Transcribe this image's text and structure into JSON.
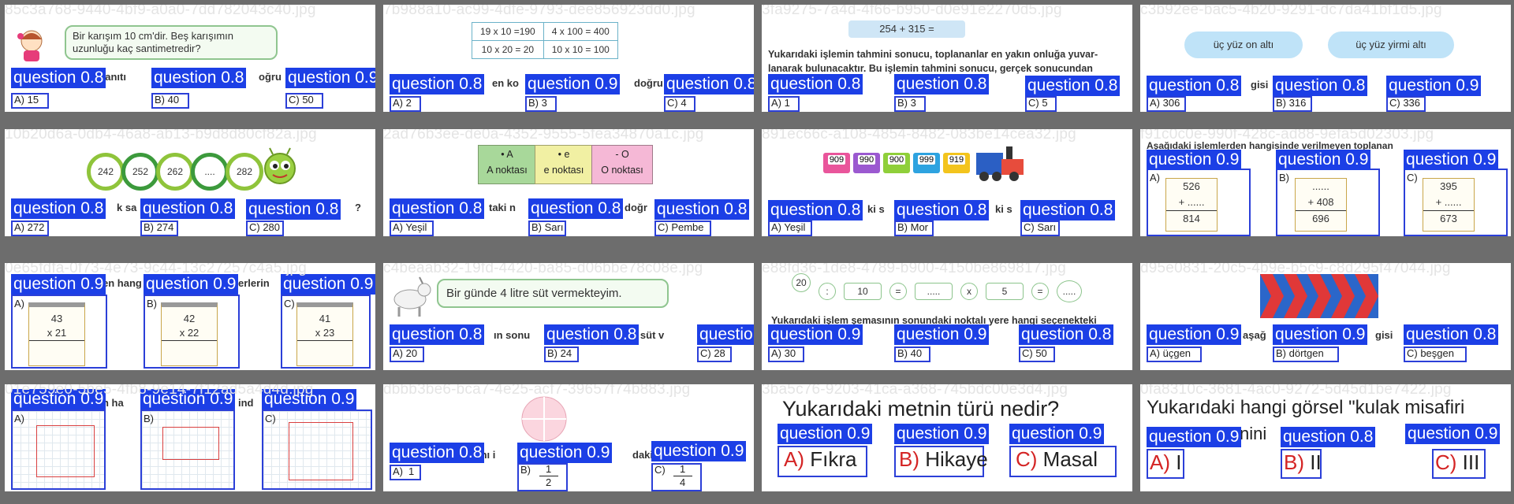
{
  "tiles": [
    {
      "filename": "85c3a768-9440-4bf9-a0a0-7dd782043c40.jpg",
      "question_text": "Bir karışım 10 cm'dir. Beş karışımın uzunluğu kaç santimetredir?",
      "fragments": [
        "yanıtı",
        "oğru"
      ],
      "labels": [
        "question 0.8",
        "question 0.8",
        "question 0.9"
      ],
      "options": [
        "A) 15",
        "B) 40",
        "C) 50"
      ]
    },
    {
      "filename": "7b988a10-ac99-4dfe-9793-dee856923dd0.jpg",
      "table": [
        [
          "19 x 10 =190",
          "4 x 100 = 400"
        ],
        [
          "10 x 20 = 20",
          "10 x 10 = 100"
        ]
      ],
      "fragments": [
        "en ko",
        "doğru"
      ],
      "labels": [
        "question 0.8",
        "question 0.9",
        "question 0.8"
      ],
      "options": [
        "A) 2",
        "B) 3",
        "C) 4"
      ]
    },
    {
      "filename": "3fa9275-7a4d-4f66-b950-d0e91e2270d5.jpg",
      "header": "254 + 315 =",
      "paragraph": [
        "Yukarıdaki işlemin tahmini sonucu, toplananlar en yakın onluğa yuvar-",
        "lanarak bulunacaktır. Bu işlemin tahmini sonucu, gerçek sonucundan"
      ],
      "labels": [
        "question 0.8",
        "question 0.8",
        "question 0.8"
      ],
      "options": [
        "A) 1",
        "B) 3",
        "C) 5"
      ]
    },
    {
      "filename": "c3b92ee-bac5-4b20-9291-dc7da41bf1d5.jpg",
      "clouds": [
        "üç yüz on altı",
        "üç yüz yirmi altı"
      ],
      "fragments": [
        "gisi"
      ],
      "labels": [
        "question 0.8",
        "question 0.8",
        "question 0.9"
      ],
      "options": [
        "A) 306",
        "B) 316",
        "C) 336"
      ]
    },
    {
      "filename": "10b20d6a-0db4-46a8-ab13-b9d8d80cf82a.jpg",
      "rings": [
        "242",
        "252",
        "262",
        "....",
        "282"
      ],
      "fragments": [
        "k sa",
        "?"
      ],
      "labels": [
        "question 0.8",
        "question 0.8",
        "question 0.8"
      ],
      "options": [
        "A) 272",
        "B) 274",
        "C) 280"
      ]
    },
    {
      "filename": "2ad76b3ee-de0a-4352-9555-5fea34870a1c.jpg",
      "points": [
        {
          "top": "• A",
          "bottom": "A noktası",
          "color": "#a8d89a"
        },
        {
          "top": "• e",
          "bottom": "e noktası",
          "color": "#f1f0a3"
        },
        {
          "top": "- O",
          "bottom": "O noktası",
          "color": "#f5b8d6"
        }
      ],
      "fragments": [
        "taki n",
        "doğr"
      ],
      "labels": [
        "question 0.8",
        "question 0.8",
        "question 0.8"
      ],
      "options": [
        "A) Yeşil",
        "B) Sarı",
        "C) Pembe"
      ]
    },
    {
      "filename": "891ec66c-a108-4854-8482-083be14cea32.jpg",
      "wagons": [
        {
          "value": "909",
          "color": "#e9559b"
        },
        {
          "value": "990",
          "color": "#9b59d0"
        },
        {
          "value": "900",
          "color": "#8fcf3a"
        },
        {
          "value": "999",
          "color": "#2ea3e0"
        },
        {
          "value": "919",
          "color": "#f3c41d"
        }
      ],
      "fragments": [
        "ki s",
        "ki s"
      ],
      "labels": [
        "question 0.8",
        "question 0.8",
        "question 0.8"
      ],
      "options": [
        "A) Yeşil",
        "B) Mor",
        "C) Sarı"
      ]
    },
    {
      "filename": "f91c0c0e-990f-428c-ad88-9efa5d02303.jpg",
      "header": "Aşağıdaki işlemlerden hangisinde verilmeyen toplanan",
      "cards": [
        {
          "letter": "A)",
          "lines": [
            "526",
            "+ ......",
            "814"
          ]
        },
        {
          "letter": "B)",
          "lines": [
            "......",
            "+ 408",
            "696"
          ]
        },
        {
          "letter": "C)",
          "lines": [
            "395",
            "+ ......",
            "673"
          ]
        }
      ],
      "labels": [
        "question 0.9",
        "question 0.9",
        "question 0.9"
      ]
    },
    {
      "filename": "0e65fdfa-0f73-4e73-9c44-13c27257c4a5.jpg",
      "fragments": [
        "en hang",
        "erlerin"
      ],
      "cards": [
        {
          "letter": "A)",
          "lines": [
            "43",
            "x  21"
          ]
        },
        {
          "letter": "B)",
          "lines": [
            "42",
            "x  22"
          ]
        },
        {
          "letter": "C)",
          "lines": [
            "41",
            "x  23"
          ]
        }
      ],
      "labels": [
        "question 0.9",
        "question 0.9",
        "question 0.9"
      ]
    },
    {
      "filename": "c4beaab32-19fd-4420-ba85-d06bbe78c08e.jpg",
      "bubble": "Bir günde 4 litre süt vermekteyim.",
      "fragments": [
        "ın sonu",
        "re süt v"
      ],
      "labels": [
        "question 0.8",
        "question 0.8",
        "question 0.8"
      ],
      "options": [
        "A) 20",
        "B) 24",
        "C) 28"
      ]
    },
    {
      "filename": "e88fd36-1de8-4789-b900-4150be869817.jpg",
      "chain": [
        "20",
        ":",
        "10",
        "=",
        ".....",
        "x",
        "5",
        "=",
        "....."
      ],
      "paragraph": "Yukarıdaki işlem şemasının sonundaki noktalı yere hangi seçenekteki",
      "labels": [
        "question 0.9",
        "question 0.9",
        "question 0.8"
      ],
      "options": [
        "A) 30",
        "B) 40",
        "C) 50"
      ]
    },
    {
      "filename": "d95e0831-20c5-4b9e-b5c9-c8d295f47044.jpg",
      "fragments": [
        "aşağ",
        "gisi"
      ],
      "labels": [
        "question 0.9",
        "question 0.9",
        "question 0.8"
      ],
      "options": [
        "A) üçgen",
        "B) dörtgen",
        "C) beşgen"
      ]
    },
    {
      "filename": "01e759e0-5be5-4fb8-9e14-7f12ad5a4d4d.jpg",
      "fragments": [
        "n ha",
        "ind"
      ],
      "letters": [
        "A)",
        "B)",
        "C)"
      ],
      "labels": [
        "question 0.9",
        "question 0.9",
        "question 0.9"
      ]
    },
    {
      "filename": "dbbb3be6-bca7-4e25-acf7-39657f74b883.jpg",
      "fragments": [
        "mı i",
        "daki"
      ],
      "fractions": [
        {
          "letter": "A)",
          "value": "1"
        },
        {
          "letter": "B)",
          "num": "1",
          "den": "2"
        },
        {
          "letter": "C)",
          "num": "1",
          "den": "4"
        }
      ],
      "labels": [
        "question 0.8",
        "question 0.9",
        "question 0.9"
      ]
    },
    {
      "filename": "3ba5c76-9203-41ca-a368-745bdc00e3d4.jpg",
      "question_text": "Yukarıdaki metnin türü nedir?",
      "options": [
        {
          "l": "A)",
          "t": "Fıkra"
        },
        {
          "l": "B)",
          "t": "Hikaye"
        },
        {
          "l": "C)",
          "t": "Masal"
        }
      ],
      "labels": [
        "question 0.9",
        "question 0.9",
        "question 0.9"
      ]
    },
    {
      "filename": "0fa8310c-3681-4ac0-9272-5d45d1be7422.jpg",
      "question_text": "Yukarıdaki hangi görsel \"kulak misafiri",
      "fragments": [
        "nini"
      ],
      "options": [
        {
          "l": "A)",
          "t": "I"
        },
        {
          "l": "B)",
          "t": "II"
        },
        {
          "l": "C)",
          "t": "III"
        }
      ],
      "labels": [
        "question 0.9",
        "question 0.8",
        "question 0.9"
      ]
    }
  ]
}
